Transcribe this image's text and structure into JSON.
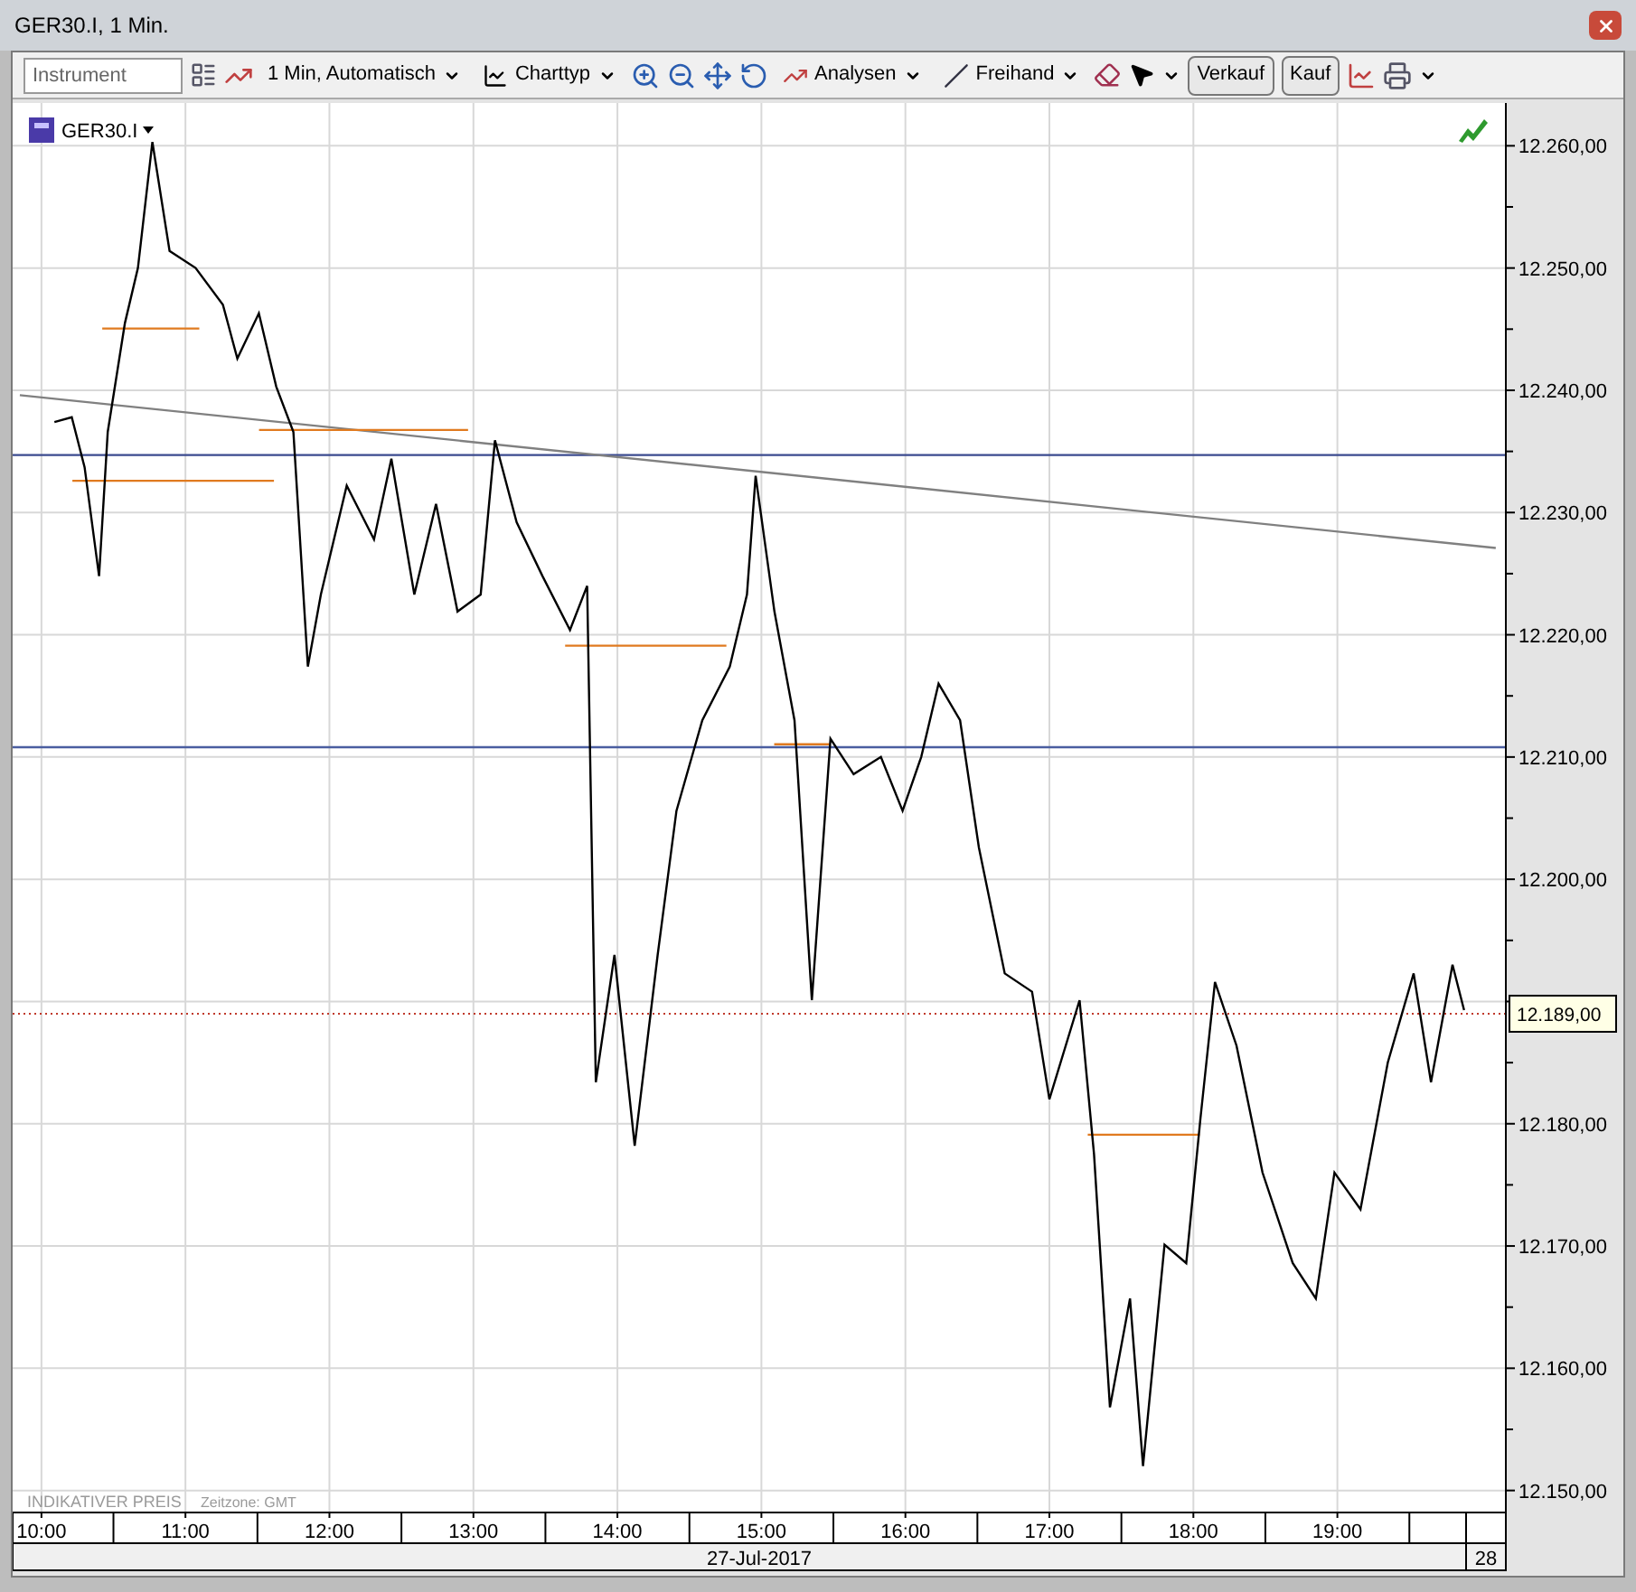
{
  "window": {
    "title": "GER30.I, 1 Min."
  },
  "toolbar": {
    "instrument": {
      "placeholder": "Instrument"
    },
    "interval": "1 Min, Automatisch",
    "chart_type": "Charttyp",
    "analyses": "Analysen",
    "freehand": "Freihand",
    "sell": "Verkauf",
    "buy": "Kauf"
  },
  "chart": {
    "footer_note": "INDIKATIVER PREIS",
    "timezone": "Zeitzone: GMT",
    "date": "27-Jul-2017",
    "next_day": "28",
    "chart_data": {
      "type": "line",
      "grid": true,
      "x": [
        10.09,
        10.21,
        10.3,
        10.4,
        10.46,
        10.58,
        10.67,
        10.77,
        10.89,
        11.07,
        11.26,
        11.36,
        11.51,
        11.63,
        11.75,
        11.85,
        11.94,
        12.12,
        12.31,
        12.43,
        12.59,
        12.74,
        12.89,
        13.05,
        13.15,
        13.3,
        13.48,
        13.67,
        13.79,
        13.85,
        13.98,
        14.12,
        14.28,
        14.41,
        14.59,
        14.78,
        14.9,
        14.96,
        15.09,
        15.23,
        15.35,
        15.48,
        15.64,
        15.83,
        15.98,
        16.11,
        16.23,
        16.38,
        16.51,
        16.69,
        16.88,
        17.0,
        17.21,
        17.31,
        17.42,
        17.56,
        17.65,
        17.8,
        17.95,
        18.05,
        18.15,
        18.3,
        18.48,
        18.69,
        18.85,
        18.98,
        19.16,
        19.35,
        19.53,
        19.65,
        19.8,
        19.88
      ],
      "series": [
        {
          "name": "GER30.I",
          "color": "#000000",
          "values": [
            12237.4,
            12237.8,
            12233.7,
            12224.8,
            12236.6,
            12245.5,
            12250,
            12260.3,
            12251.4,
            12250,
            12247,
            12242.6,
            12246.3,
            12240.3,
            12236.6,
            12217.4,
            12223.3,
            12232.2,
            12227.8,
            12234.4,
            12223.3,
            12230.7,
            12221.9,
            12223.3,
            12235.9,
            12229.2,
            12224.8,
            12220.4,
            12224,
            12183.4,
            12193.8,
            12178.2,
            12193.8,
            12205.6,
            12213,
            12217.4,
            12223.3,
            12233,
            12221.9,
            12213,
            12190.1,
            12211.5,
            12208.6,
            12210,
            12205.6,
            12210,
            12216,
            12213,
            12202.6,
            12192.3,
            12190.8,
            12182,
            12190.1,
            12177.5,
            12156.8,
            12165.7,
            12152,
            12170.1,
            12168.6,
            12180.5,
            12191.6,
            12186.4,
            12176,
            12168.6,
            12165.7,
            12176,
            12173,
            12185,
            12192.3,
            12183.4,
            12193,
            12189.3
          ]
        },
        {
          "color": "#808080",
          "x": [
            9.85,
            20.1
          ],
          "values": [
            12239.6,
            12227.1
          ]
        }
      ],
      "xlim": [
        9.8,
        20.17
      ],
      "ylim": [
        12148.2,
        12263.5
      ],
      "xticks": [
        {
          "value": 10,
          "label": "10:00"
        },
        {
          "value": 11,
          "label": "11:00"
        },
        {
          "value": 12,
          "label": "12:00"
        },
        {
          "value": 13,
          "label": "13:00"
        },
        {
          "value": 14,
          "label": "14:00"
        },
        {
          "value": 15,
          "label": "15:00"
        },
        {
          "value": 16,
          "label": "16:00"
        },
        {
          "value": 17,
          "label": "17:00"
        },
        {
          "value": 18,
          "label": "18:00"
        },
        {
          "value": 19,
          "label": "19:00"
        }
      ],
      "yticks": [
        {
          "value": 12150,
          "label": "12.150,00"
        },
        {
          "value": 12160,
          "label": "12.160,00"
        },
        {
          "value": 12170,
          "label": "12.170,00"
        },
        {
          "value": 12180,
          "label": "12.180,00"
        },
        {
          "value": 12200,
          "label": "12.200,00"
        },
        {
          "value": 12210,
          "label": "12.210,00"
        },
        {
          "value": 12220,
          "label": "12.220,00"
        },
        {
          "value": 12230,
          "label": "12.230,00"
        },
        {
          "value": 12240,
          "label": "12.240,00"
        },
        {
          "value": 12250,
          "label": "12.250,00"
        },
        {
          "value": 12260,
          "label": "12.260,00"
        }
      ],
      "ref_lines": [
        {
          "axis": "y",
          "value": 12234.7,
          "color": "#3b4a8f"
        },
        {
          "axis": "y",
          "value": 12210.8,
          "color": "#4a5ea0"
        },
        {
          "axis": "y",
          "value": 12189,
          "color": "#c0392b",
          "label": "12.189,00"
        }
      ]
    }
  }
}
